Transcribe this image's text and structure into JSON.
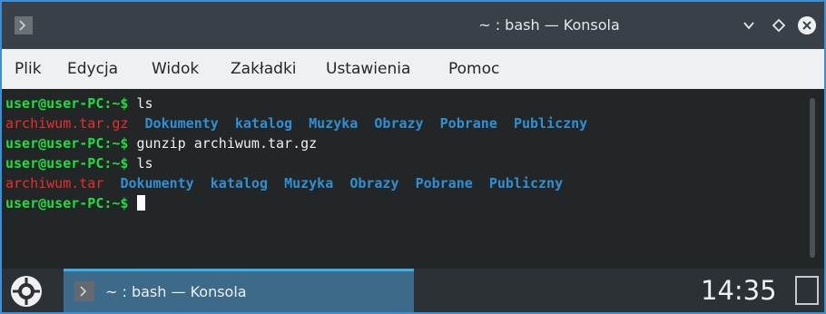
{
  "window": {
    "title": "~ : bash — Konsola",
    "app_icon": "terminal-icon",
    "buttons": [
      "minimize-chevron-icon",
      "maximize-diamond-icon",
      "close-icon"
    ]
  },
  "menu": {
    "items": [
      "Plik",
      "Edycja",
      "Widok",
      "Zakładki",
      "Ustawienia",
      "Pomoc"
    ]
  },
  "terminal": {
    "prompt": "user@user-PC:~$",
    "lines": [
      {
        "command": " ls"
      },
      {
        "archive": "archiwum.tar.gz",
        "dirs": [
          "Dokumenty",
          "katalog",
          "Muzyka",
          "Obrazy",
          "Pobrane",
          "Publiczny"
        ]
      },
      {
        "command": " gunzip archiwum.tar.gz"
      },
      {
        "command": " ls"
      },
      {
        "archive": "archiwum.tar",
        "dirs": [
          "Dokumenty",
          "katalog",
          "Muzyka",
          "Obrazy",
          "Pobrane",
          "Publiczny"
        ]
      },
      {
        "command": " "
      }
    ]
  },
  "taskbar": {
    "launcher_icon": "kde-launcher-icon",
    "task_label": "~ : bash — Konsola",
    "clock": "14:35",
    "show_desktop_icon": "show-desktop-icon"
  },
  "colors": {
    "prompt": "#1ede3e",
    "archive": "#ed2b2b",
    "directory": "#2e90d4",
    "terminal_bg": "#232627",
    "accent": "#3daee9"
  }
}
